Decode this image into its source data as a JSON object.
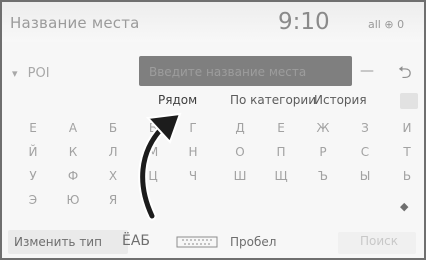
{
  "header": {
    "title": "Название места",
    "time": "9:10",
    "signal": "all ⊕ 0"
  },
  "search": {
    "filter_label": "РОІ",
    "placeholder": "Введите название места",
    "delete_icon": "backspace-icon",
    "back_icon": "return-icon"
  },
  "tabs": [
    {
      "label": "Рядом",
      "active": true
    },
    {
      "label": "По категории",
      "active": false
    },
    {
      "label": "История",
      "active": false
    }
  ],
  "keyboard": {
    "rows": [
      [
        "Е",
        "А",
        "Б",
        "В",
        "Г",
        "Д",
        "Е",
        "Ж",
        "З",
        "И"
      ],
      [
        "Й",
        "К",
        "Л",
        "М",
        "Н",
        "О",
        "П",
        "Р",
        "С",
        "Т"
      ],
      [
        "У",
        "Ф",
        "Х",
        "Ц",
        "Ч",
        "Ш",
        "Щ",
        "Ъ",
        "Ы",
        "Ь"
      ],
      [
        "Э",
        "Ю",
        "Я"
      ]
    ]
  },
  "bottom": {
    "change_type": "Изменить тип",
    "script": "ЁАБ",
    "space": "Пробел",
    "search": "Поиск"
  }
}
